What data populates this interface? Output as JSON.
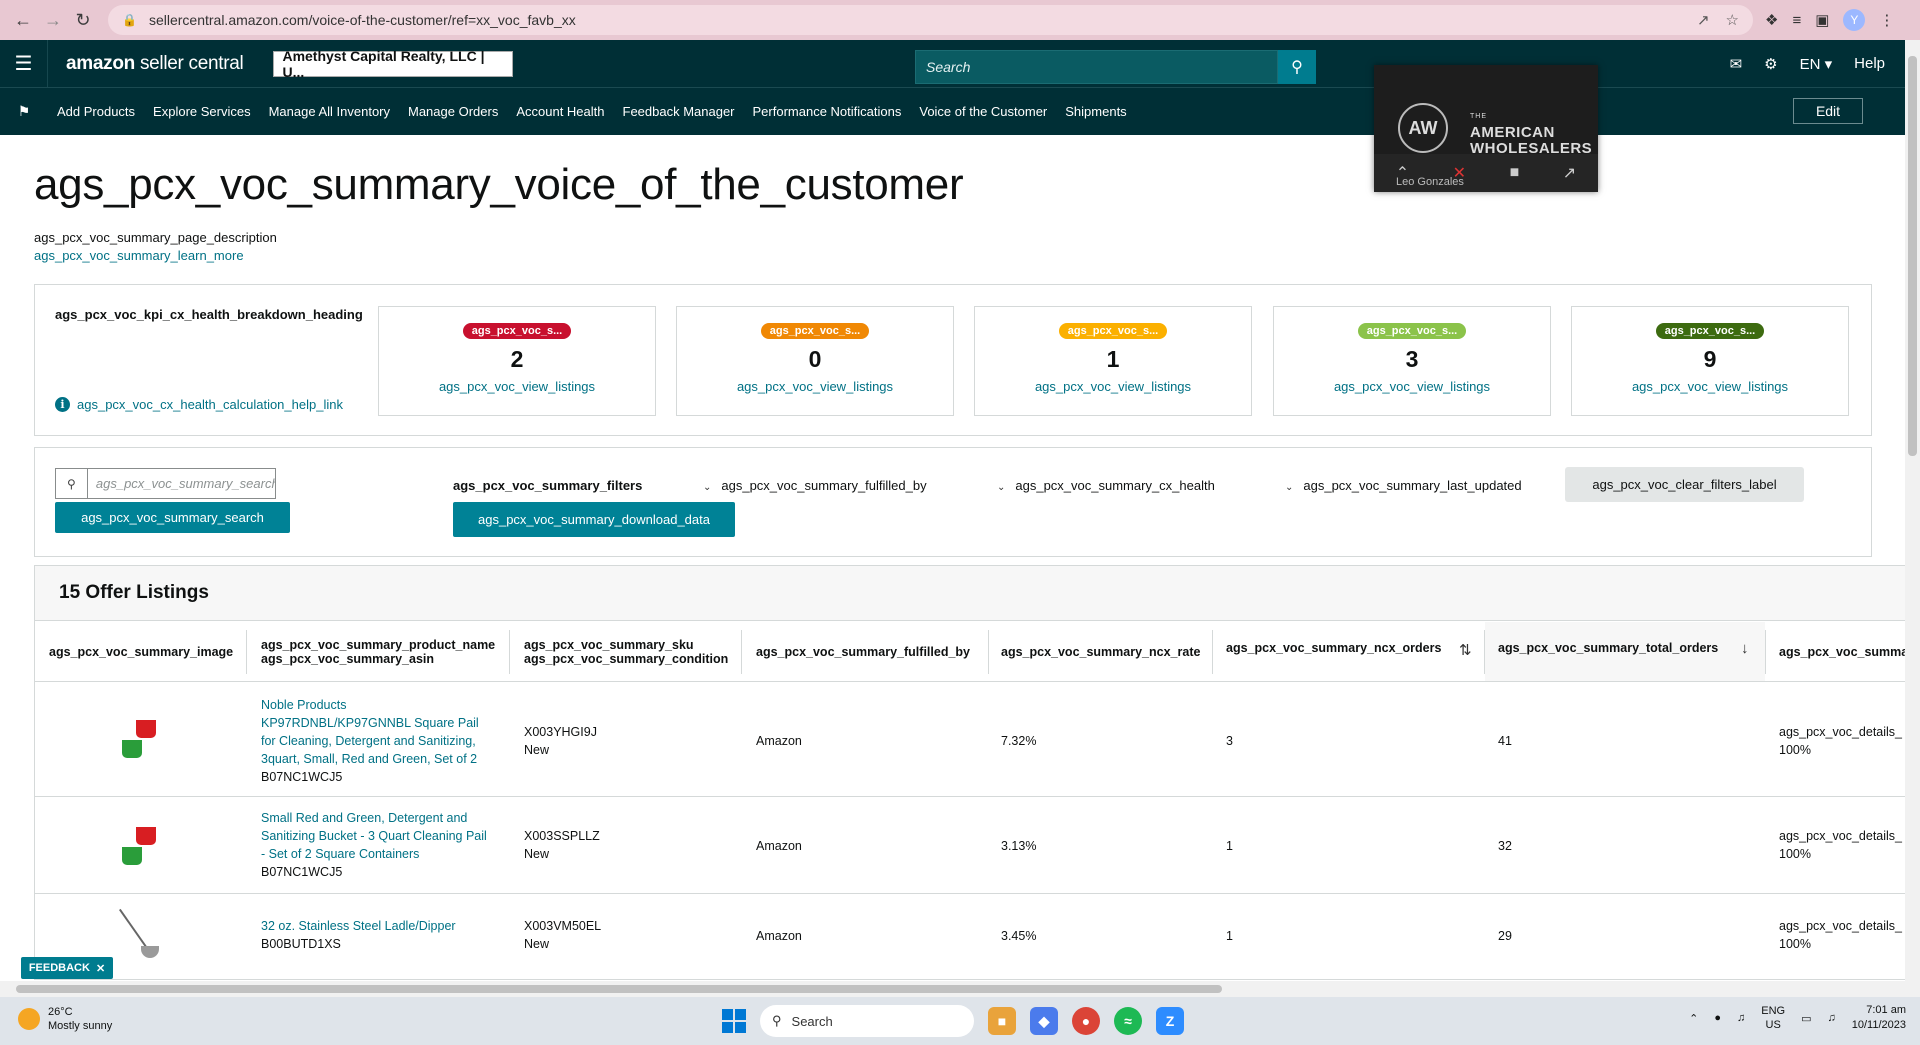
{
  "browser": {
    "url": "sellercentral.amazon.com/voice-of-the-customer/ref=xx_voc_favb_xx",
    "profile_initial": "Y"
  },
  "header": {
    "logo_brand": "amazon",
    "logo_product": "seller central",
    "account": "Amethyst Capital Realty, LLC | U...",
    "search_placeholder": "Search",
    "language": "EN",
    "help": "Help"
  },
  "nav": {
    "items": [
      "Add Products",
      "Explore Services",
      "Manage All Inventory",
      "Manage Orders",
      "Account Health",
      "Feedback Manager",
      "Performance Notifications",
      "Voice of the Customer",
      "Shipments"
    ],
    "edit": "Edit"
  },
  "video_overlay": {
    "brand_small": "THE",
    "brand_line1": "AMERICAN",
    "brand_line2": "WHOLESALERS",
    "logo_letters": "AW",
    "person": "Leo Gonzales"
  },
  "page": {
    "title": "ags_pcx_voc_summary_voice_of_the_customer",
    "description": "ags_pcx_voc_summary_page_description",
    "learn_more": "ags_pcx_voc_summary_learn_more"
  },
  "kpi": {
    "heading": "ags_pcx_voc_kpi_cx_health_breakdown_heading",
    "help_link": "ags_pcx_voc_cx_health_calculation_help_link",
    "cards": [
      {
        "badge": "ags_pcx_voc_s...",
        "count": "2",
        "link": "ags_pcx_voc_view_listings",
        "color": "#c8102e"
      },
      {
        "badge": "ags_pcx_voc_s...",
        "count": "0",
        "link": "ags_pcx_voc_view_listings",
        "color": "#f08804"
      },
      {
        "badge": "ags_pcx_voc_s...",
        "count": "1",
        "link": "ags_pcx_voc_view_listings",
        "color": "#fbb000"
      },
      {
        "badge": "ags_pcx_voc_s...",
        "count": "3",
        "link": "ags_pcx_voc_view_listings",
        "color": "#8bc34a"
      },
      {
        "badge": "ags_pcx_voc_s...",
        "count": "9",
        "link": "ags_pcx_voc_view_listings",
        "color": "#3d6b10"
      }
    ]
  },
  "filters": {
    "search_placeholder": "ags_pcx_voc_summary_search",
    "search_button": "ags_pcx_voc_summary_search",
    "filters_label": "ags_pcx_voc_summary_filters",
    "download_button": "ags_pcx_voc_summary_download_data",
    "fulfilled_by": "ags_pcx_voc_summary_fulfilled_by",
    "cx_health": "ags_pcx_voc_summary_cx_health",
    "last_updated": "ags_pcx_voc_summary_last_updated",
    "clear": "ags_pcx_voc_clear_filters_label"
  },
  "table": {
    "heading": "15 Offer Listings",
    "columns": {
      "image": "ags_pcx_voc_summary_image",
      "product_name": "ags_pcx_voc_summary_product_name",
      "asin": "ags_pcx_voc_summary_asin",
      "sku": "ags_pcx_voc_summary_sku",
      "condition": "ags_pcx_voc_summary_condition",
      "fulfilled_by": "ags_pcx_voc_summary_fulfilled_by",
      "ncx_rate": "ags_pcx_voc_summary_ncx_rate",
      "ncx_orders": "ags_pcx_voc_summary_ncx_orders",
      "total_orders": "ags_pcx_voc_summary_total_orders",
      "more": "ags_pcx_voc_summa"
    },
    "rows": [
      {
        "product_lines": [
          "Noble Products",
          "KP97RDNBL/KP97GNNBL Square Pail",
          "for Cleaning, Detergent and Sanitizing,",
          "3quart, Small, Red and Green, Set of 2"
        ],
        "asin": "B07NC1WCJ5",
        "sku": "X003YHGI9J",
        "condition": "New",
        "fulfilled_by": "Amazon",
        "ncx_rate": "7.32%",
        "ncx_orders": "3",
        "total_orders": "41",
        "details": "ags_pcx_voc_details_",
        "details_pct": "100%"
      },
      {
        "product_lines": [
          "Small Red and Green, Detergent and",
          "Sanitizing Bucket - 3 Quart Cleaning Pail",
          "- Set of 2 Square Containers"
        ],
        "asin": "B07NC1WCJ5",
        "sku": "X003SSPLLZ",
        "condition": "New",
        "fulfilled_by": "Amazon",
        "ncx_rate": "3.13%",
        "ncx_orders": "1",
        "total_orders": "32",
        "details": "ags_pcx_voc_details_",
        "details_pct": "100%"
      },
      {
        "product_lines": [
          "32 oz. Stainless Steel Ladle/Dipper"
        ],
        "asin": "B00BUTD1XS",
        "sku": "X003VM50EL",
        "condition": "New",
        "fulfilled_by": "Amazon",
        "ncx_rate": "3.45%",
        "ncx_orders": "1",
        "total_orders": "29",
        "details": "ags_pcx_voc_details_",
        "details_pct": "100%"
      }
    ]
  },
  "feedback": "FEEDBACK",
  "taskbar": {
    "temp": "26°C",
    "weather": "Mostly sunny",
    "search": "Search",
    "lang1": "ENG",
    "lang2": "US",
    "time": "7:01 am",
    "date": "10/11/2023"
  }
}
